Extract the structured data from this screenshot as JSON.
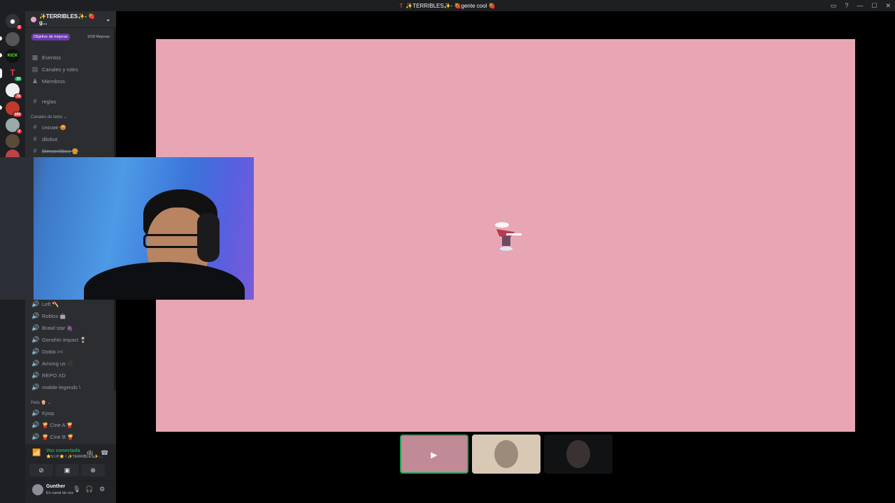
{
  "titlebar": {
    "logo": "T",
    "title": "✨TERRIBLES✨- 🍓gente cool 🍓"
  },
  "guilds": {
    "items": [
      {
        "name": "discord-home",
        "label": "",
        "badge": "2"
      },
      {
        "name": "guild-1",
        "label": "",
        "badge": ""
      },
      {
        "name": "guild-kick",
        "label": "KICK",
        "badge": ""
      },
      {
        "name": "guild-terribles",
        "label": "T",
        "badge": "10"
      },
      {
        "name": "guild-4",
        "label": "",
        "badge": "76"
      },
      {
        "name": "guild-5",
        "label": "",
        "badge": "190"
      },
      {
        "name": "guild-6",
        "label": "",
        "badge": "1"
      },
      {
        "name": "guild-7",
        "label": "",
        "badge": ""
      },
      {
        "name": "guild-8",
        "label": "",
        "badge": ""
      }
    ]
  },
  "server": {
    "name": "✨TERRIBLES✨- 🍓g...",
    "boost_goal": "Objetivo de mejoras",
    "boost_count": "9/28 Mejoras"
  },
  "nav": {
    "events": "Eventos",
    "channels_roles": "Canales y roles",
    "members": "Miembros"
  },
  "text_channels": {
    "rules": "reglas",
    "category": "Canales de texto",
    "items": [
      "ᴄʜɪꜱᴍᴇ-😡",
      "dilobot",
      "Bimsonlibos-🍔"
    ]
  },
  "voice_channels": {
    "items": [
      "Left 🪓",
      "Roblox 🤖",
      "Brawl star 🍇",
      "Genshin impact 🍷",
      "Dotita ><",
      "Among us 🫥",
      "REPO XD",
      "mobile-legends \\"
    ]
  },
  "pelis": {
    "category": "Pelis 🍿",
    "items": [
      "Kpop",
      "🍟 Cine A 🍟",
      "🍟 Cine B 🍟"
    ]
  },
  "voice_status": {
    "title": "Voz conectada",
    "subtitle": "⭐V.I.P.⭐ / ✨TERRIBLES✨-..."
  },
  "user": {
    "name": "Gunther",
    "status": "En canal de voz"
  }
}
